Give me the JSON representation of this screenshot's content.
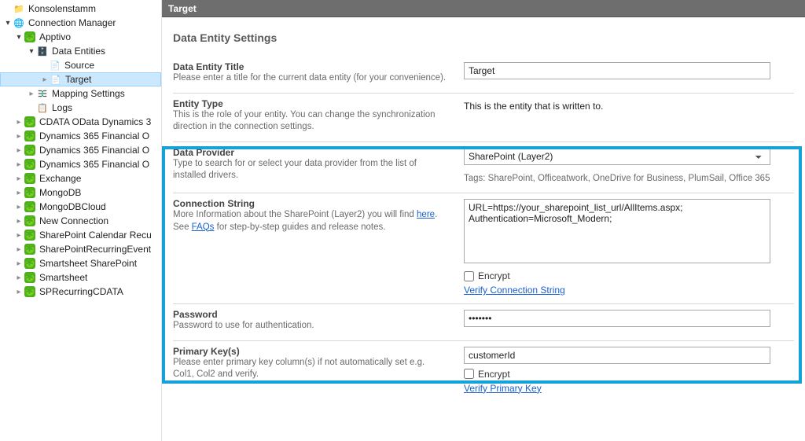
{
  "tree": {
    "root": "Konsolenstamm",
    "cm": "Connection Manager",
    "apptivo": "Apptivo",
    "de": "Data Entities",
    "source": "Source",
    "target": "Target",
    "mapping": "Mapping Settings",
    "logs": "Logs",
    "n1": "CDATA OData Dynamics 3",
    "n2": "Dynamics 365 Financial O",
    "n3": "Dynamics 365 Financial O",
    "n4": "Dynamics 365 Financial O",
    "n5": "Exchange",
    "n6": "MongoDB",
    "n7": "MongoDBCloud",
    "n8": "New Connection",
    "n9": "SharePoint Calendar Recu",
    "n10": "SharePointRecurringEvent",
    "n11": "Smartsheet SharePoint",
    "n12": "Smartsheet",
    "n13": "SPRecurringCDATA"
  },
  "header": "Target",
  "section_title": "Data Entity Settings",
  "fields": {
    "title": {
      "label": "Data Entity Title",
      "desc": "Please enter a title for the current data entity (for your convenience).",
      "value": "Target"
    },
    "entity_type": {
      "label": "Entity Type",
      "desc": "This is the role of your entity. You can change the synchronization direction in the connection settings.",
      "value": "This is the entity that is written to."
    },
    "provider": {
      "label": "Data Provider",
      "desc": "Type to search for or select your data provider from the list of installed drivers.",
      "value": "SharePoint (Layer2)",
      "tags": "Tags: SharePoint, Officeatwork, OneDrive for Business, PlumSail, Office 365"
    },
    "conn": {
      "label": "Connection String",
      "desc_pre": "More Information about the SharePoint (Layer2) you will find ",
      "here": "here",
      "desc_mid": ". See ",
      "faqs": "FAQs",
      "desc_post": " for step-by-step guides and release notes.",
      "value": "URL=https://your_sharepoint_list_url/AllItems.aspx;\nAuthentication=Microsoft_Modern;",
      "encrypt": "Encrypt",
      "verify": "Verify Connection String"
    },
    "password": {
      "label": "Password",
      "desc": "Password to use for authentication.",
      "value": "•••••••"
    },
    "pk": {
      "label": "Primary Key(s)",
      "desc": "Please enter primary key column(s) if not automatically set e.g. Col1, Col2 and verify.",
      "value": "customerId",
      "encrypt": "Encrypt",
      "verify": "Verify Primary Key"
    }
  }
}
